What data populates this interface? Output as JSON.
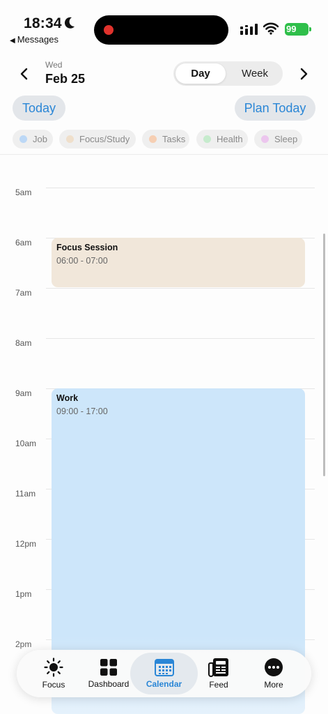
{
  "status_bar": {
    "time": "18:34",
    "back_app": "Messages",
    "battery": "99"
  },
  "header": {
    "weekday": "Wed",
    "date": "Feb 25",
    "view_options": [
      "Day",
      "Week"
    ],
    "selected_view": "Day",
    "today_label": "Today",
    "plan_today_label": "Plan Today"
  },
  "categories": [
    {
      "label": "Job",
      "color": "#bcd8f6"
    },
    {
      "label": "Focus/Study",
      "color": "#efdfcb"
    },
    {
      "label": "Tasks",
      "color": "#f6cfb3"
    },
    {
      "label": "Health",
      "color": "#c6ebcd"
    },
    {
      "label": "Sleep",
      "color": "#ecc6ee"
    }
  ],
  "hours": [
    "5am",
    "6am",
    "7am",
    "8am",
    "9am",
    "10am",
    "11am",
    "12pm",
    "1pm",
    "2pm"
  ],
  "events": [
    {
      "title": "Focus Session",
      "time": "06:00 - 07:00",
      "color": "#f1e7da"
    },
    {
      "title": "Work",
      "time": "09:00 - 17:00",
      "color": "#cde6fa"
    }
  ],
  "tabs": [
    {
      "label": "Focus",
      "icon": "sun-icon"
    },
    {
      "label": "Dashboard",
      "icon": "grid-icon"
    },
    {
      "label": "Calendar",
      "icon": "calendar-icon",
      "active": true
    },
    {
      "label": "Feed",
      "icon": "newspaper-icon"
    },
    {
      "label": "More",
      "icon": "more-icon"
    }
  ],
  "accent_color": "#2a86d6"
}
